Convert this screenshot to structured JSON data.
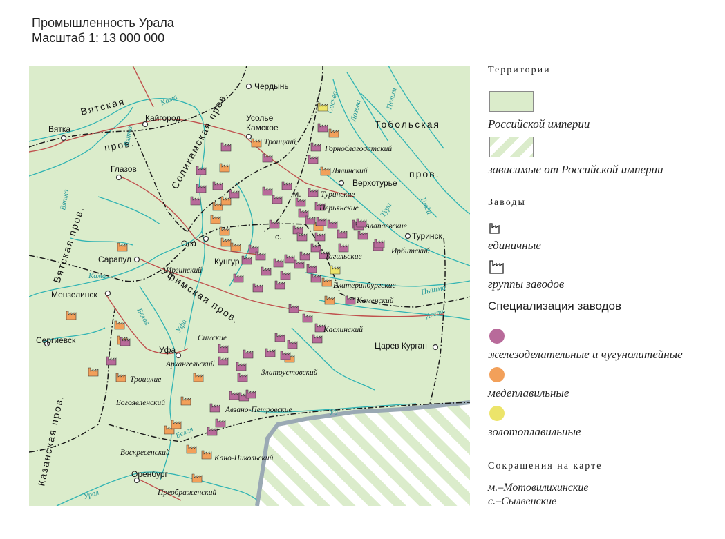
{
  "title": {
    "line1": "Промышленность Урала",
    "line2": "Масштаб 1: 13 000 000"
  },
  "colors": {
    "russia": "#dbeccb",
    "dependent_stripe": "#eef5e4",
    "water": "#2fb3b3",
    "road": "#c0504d",
    "iron": "#b86a9a",
    "copper": "#f2a05a",
    "gold": "#ece46a",
    "border": "#1a1a1a"
  },
  "legend": {
    "territories_header": "Территории",
    "russia_label": "Российской империи",
    "dependent_label": "зависимые от Российской империи",
    "plants_header": "Заводы",
    "single_label": "единичные",
    "groups_label": "группы заводов",
    "specialization_header": "Специализация заводов",
    "iron_label": "железоделательные и чугунолитейные",
    "copper_label": "медеплавильные",
    "gold_label": "золотоплавильные",
    "abbr_header": "Сокращения на карте",
    "abbr_m": "м.–Мотовилихинские",
    "abbr_s": "с.–Сылвенские"
  },
  "map": {
    "cities": [
      "Чердынь",
      "Усолье",
      "Камское",
      "Вятка",
      "Кайгород",
      "Глазов",
      "Верхотурье",
      "Туринск",
      "Оса",
      "Кунгур",
      "Сарапул",
      "Мензелинск",
      "Сергиевск",
      "Уфа",
      "Оренбург",
      "Царев Курган",
      "м.",
      "с."
    ],
    "provinces": [
      "Вятская",
      "пров.",
      "Соликамская пров.",
      "Тобольская",
      "пров.",
      "Уфимская пров.",
      "Казанская пров.",
      "Вятская пров."
    ],
    "rivers": [
      "Кама",
      "Вятка",
      "Вятка",
      "Кама",
      "Белая",
      "Уфа",
      "Сосьва",
      "Лозьва",
      "Пелым",
      "Тавда",
      "Тура",
      "Пышма",
      "Исеть",
      "Белая",
      "Урал",
      "Уй"
    ],
    "plants": [
      "Троицкий",
      "Горноблагодатский",
      "Лялинский",
      "Туринские",
      "Нерьянские",
      "Алапаевские",
      "Ирбитский",
      "Тагильские",
      "Иргинский",
      "Екатеринбургские",
      "Каменский",
      "Каслинский",
      "Симские",
      "Архангельский",
      "Златоустовский",
      "Троицкие",
      "Богоявленский",
      "Авзано-Петровские",
      "Воскресенский",
      "Кано-Никольский",
      "Преображенский"
    ]
  }
}
